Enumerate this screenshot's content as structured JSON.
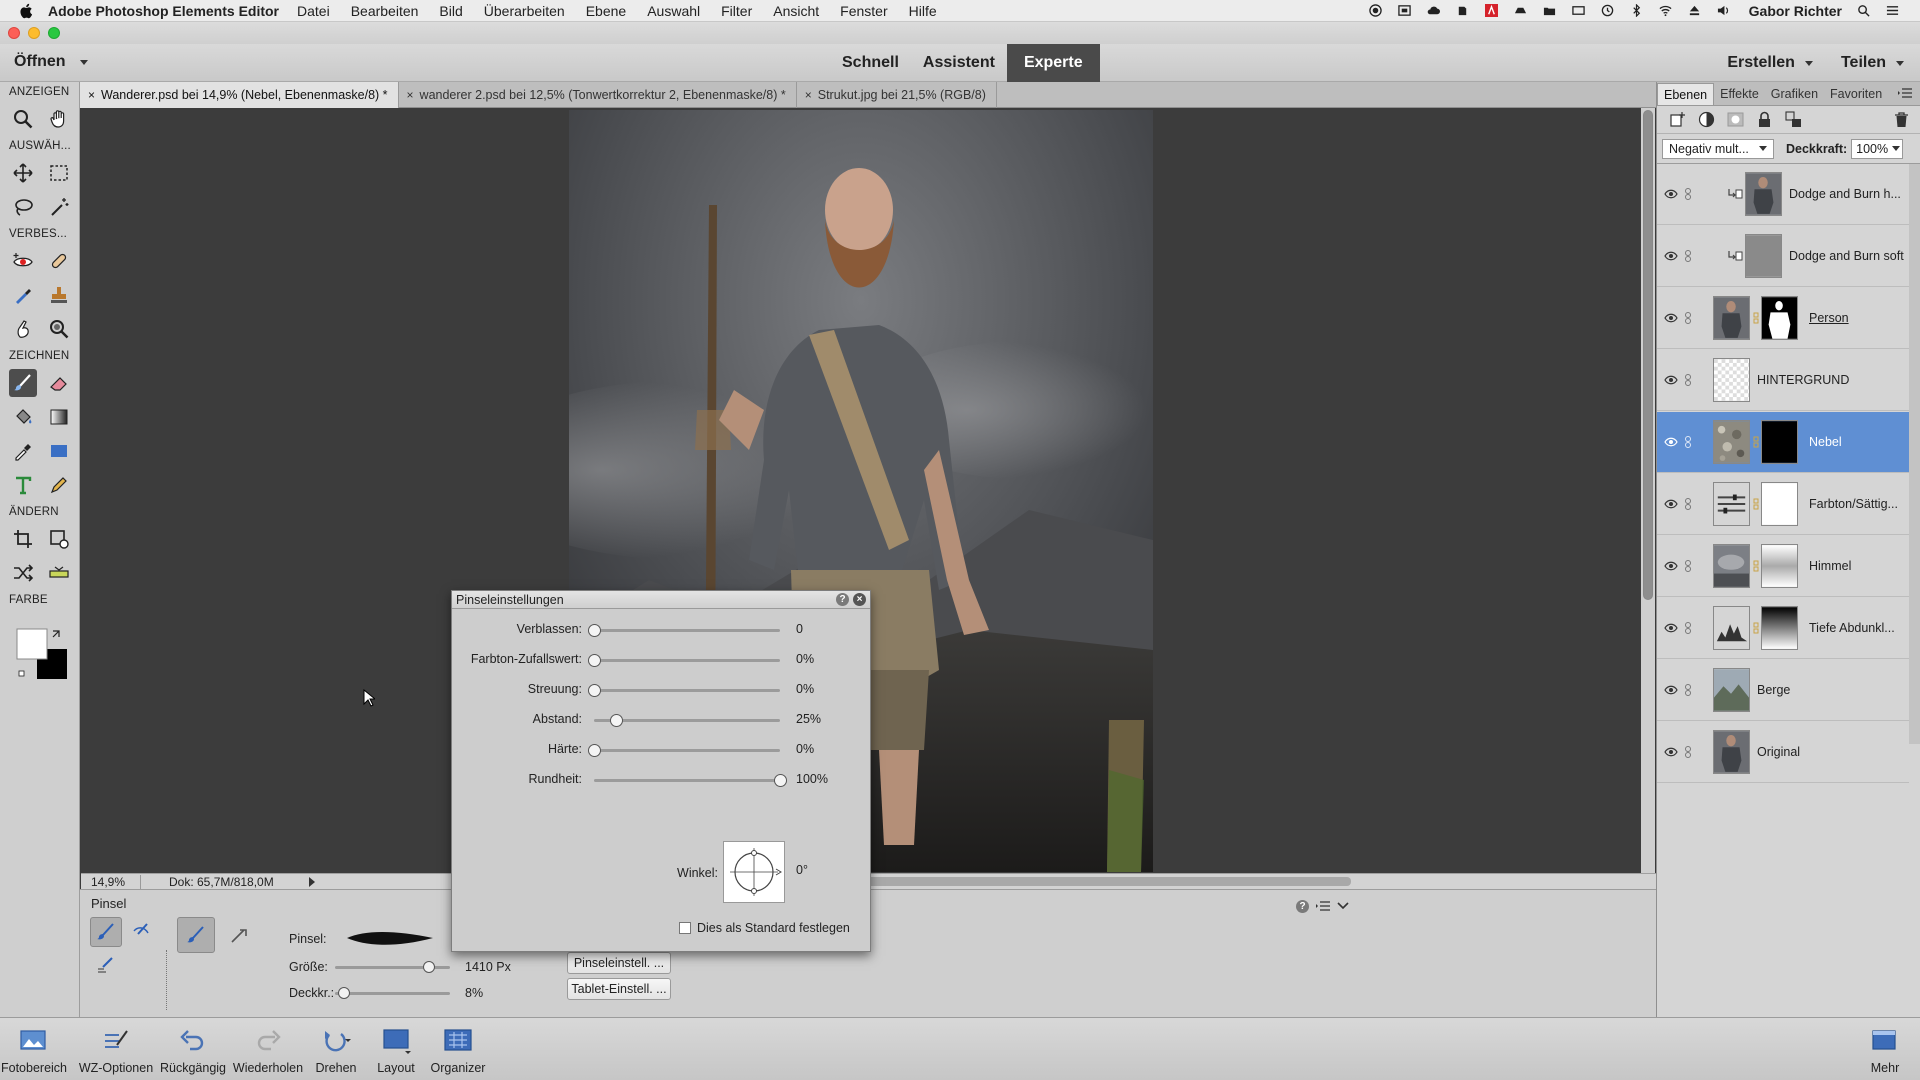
{
  "menubar": {
    "app_name": "Adobe Photoshop Elements Editor",
    "items": [
      "Datei",
      "Bearbeiten",
      "Bild",
      "Überarbeiten",
      "Ebene",
      "Auswahl",
      "Filter",
      "Ansicht",
      "Fenster",
      "Hilfe"
    ],
    "user": "Gabor Richter"
  },
  "modebar": {
    "open_label": "Öffnen",
    "tabs": [
      "Schnell",
      "Assistent",
      "Experte"
    ],
    "active_tab": "Experte",
    "create_label": "Erstellen",
    "share_label": "Teilen"
  },
  "toolbox": {
    "sections": [
      "ANZEIGEN",
      "AUSWÄH...",
      "VERBES...",
      "ZEICHNEN",
      "ÄNDERN",
      "FARBE"
    ],
    "active_tool": "brush-tool"
  },
  "doc_tabs": [
    {
      "label": "Wanderer.psd bei 14,9% (Nebel, Ebenenmaske/8) *",
      "active": true
    },
    {
      "label": "wanderer 2.psd bei 12,5% (Tonwertkorrektur 2, Ebenenmaske/8) *",
      "active": false
    },
    {
      "label": "Strukut.jpg bei 21,5% (RGB/8)",
      "active": false
    }
  ],
  "status": {
    "zoom": "14,9%",
    "doc_size": "Dok: 65,7M/818,0M"
  },
  "tool_options": {
    "title": "Pinsel",
    "brush_label": "Pinsel:",
    "size_label": "Größe:",
    "size_value": "1410 Px",
    "size_fraction": 0.82,
    "opacity_label": "Deckkr.:",
    "opacity_value": "8%",
    "opacity_fraction": 0.08,
    "brush_settings_btn": "Pinseleinstell. ...",
    "tablet_settings_btn": "Tablet-Einstell. ..."
  },
  "brush_dialog": {
    "title": "Pinseleinstellungen",
    "rows": [
      {
        "label": "Verblassen:",
        "value": "0",
        "fraction": 0
      },
      {
        "label": "Farbton-Zufallswert:",
        "value": "0%",
        "fraction": 0
      },
      {
        "label": "Streuung:",
        "value": "0%",
        "fraction": 0
      },
      {
        "label": "Abstand:",
        "value": "25%",
        "fraction": 0.12
      },
      {
        "label": "Härte:",
        "value": "0%",
        "fraction": 0
      },
      {
        "label": "Rundheit:",
        "value": "100%",
        "fraction": 1
      }
    ],
    "angle_label": "Winkel:",
    "angle_value": "0°",
    "default_label": "Dies als Standard festlegen"
  },
  "layers_panel": {
    "tabs": [
      "Ebenen",
      "Effekte",
      "Grafiken",
      "Favoriten"
    ],
    "active_tab": "Ebenen",
    "blend_mode": "Negativ mult...",
    "opacity_label": "Deckkraft:",
    "opacity_value": "100%",
    "layers": [
      {
        "name": "Dodge and Burn h...",
        "thumb": "person",
        "mask": "none",
        "clip": true,
        "active": false
      },
      {
        "name": "Dodge and Burn soft",
        "thumb": "gray",
        "mask": "none",
        "clip": true,
        "active": false
      },
      {
        "name": "Person",
        "thumb": "person",
        "mask": "person",
        "clip": false,
        "active": false
      },
      {
        "name": "HINTERGRUND",
        "thumb": "checker",
        "mask": "none",
        "clip": false,
        "active": false
      },
      {
        "name": "Nebel",
        "thumb": "texture",
        "mask": "black",
        "clip": false,
        "active": true
      },
      {
        "name": "Farbton/Sättig...",
        "thumb": "adjust",
        "mask": "white",
        "clip": false,
        "active": false
      },
      {
        "name": "Himmel",
        "thumb": "sky",
        "mask": "gradient",
        "clip": false,
        "active": false
      },
      {
        "name": "Tiefe Abdunkl...",
        "thumb": "levels",
        "mask": "gradient-dark",
        "clip": false,
        "active": false
      },
      {
        "name": "Berge",
        "thumb": "mountain",
        "mask": "none",
        "clip": false,
        "active": false
      },
      {
        "name": "Original",
        "thumb": "person",
        "mask": "none",
        "clip": false,
        "active": false
      }
    ]
  },
  "taskbar": {
    "items": [
      "Fotobereich",
      "WZ-Optionen",
      "Rückgängig",
      "Wiederholen",
      "Drehen",
      "Layout",
      "Organizer"
    ],
    "more_label": "Mehr"
  }
}
